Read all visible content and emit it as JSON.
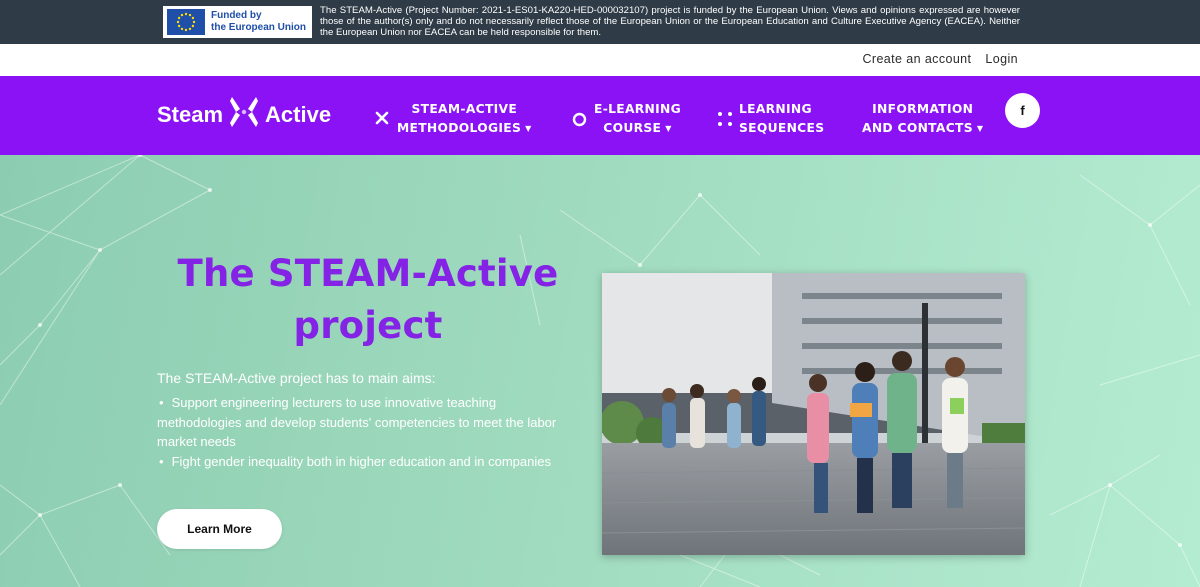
{
  "eu_banner": {
    "logo_line1": "Funded by",
    "logo_line2": "the European Union",
    "disclaimer": "The STEAM-Active (Project Number: 2021-1-ES01-KA220-HED-000032107) project is funded by the European Union. Views and opinions expressed are however those of the author(s) only and do not necessarily reflect those of the European Union or the European Education and Culture Executive Agency (EACEA). Neither the European Union nor EACEA can be held responsible for them."
  },
  "account": {
    "create_account": "Create an account",
    "login": "Login"
  },
  "nav": {
    "brand_left": "Steam",
    "brand_right": "Active",
    "items": [
      {
        "line1": "STEAM-ACTIVE",
        "line2": "METHODOLOGIES",
        "has_dropdown": true,
        "icon": "x-icon"
      },
      {
        "line1": "E-LEARNING",
        "line2": "COURSE",
        "has_dropdown": true,
        "icon": "circle-icon"
      },
      {
        "line1": "LEARNING",
        "line2": "SEQUENCES",
        "has_dropdown": false,
        "icon": "dots-grid-icon"
      },
      {
        "line1": "INFORMATION",
        "line2": "AND CONTACTS",
        "has_dropdown": true,
        "icon": ""
      }
    ],
    "facebook": "f"
  },
  "hero": {
    "title": "The STEAM-Active project",
    "intro": "The STEAM-Active project has to main aims:",
    "aims": [
      "Support engineering lecturers to use innovative teaching methodologies and develop students' competencies to meet the labor market needs",
      "Fight gender inequality both in higher education and in companies"
    ],
    "button": "Learn More"
  },
  "colors": {
    "nav_bg": "#8a12f5",
    "title": "#8422e6",
    "eu_bar": "#2f3b46",
    "hero_bg": "#a6dfc4"
  }
}
